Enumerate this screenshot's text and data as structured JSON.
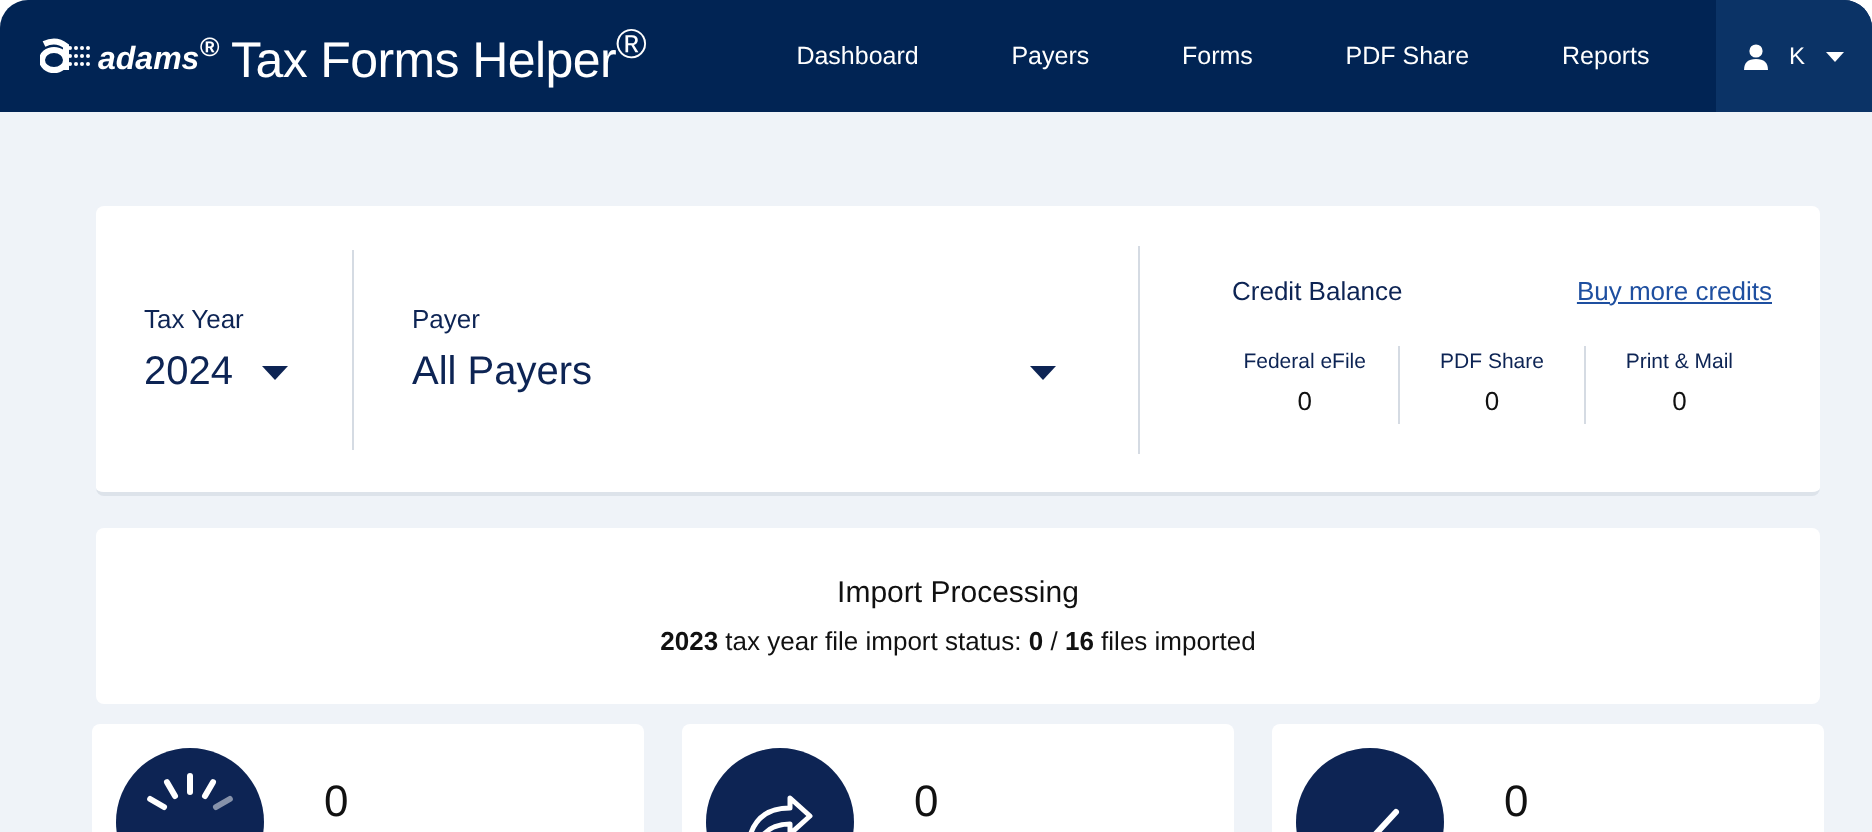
{
  "header": {
    "brand": "adams$^{®}$",
    "product": "Tax Forms Helper$^{®}$",
    "nav": [
      {
        "label": "Dashboard",
        "selected": false
      },
      {
        "label": "Payers",
        "selected": false
      },
      {
        "label": "Forms",
        "selected": false
      },
      {
        "label": "PDF Share",
        "selected": false
      },
      {
        "label": "Reports",
        "selected": false
      }
    ],
    "user": "K"
  },
  "filters": {
    "tax_year": {
      "label": "Tax Year",
      "value": "2024"
    },
    "payer": {
      "label": "Payer",
      "value": "All Payers"
    }
  },
  "credits": {
    "title": "Credit Balance",
    "link": "Buy more credits",
    "items": [
      {
        "label": "Federal eFile",
        "value": "0"
      },
      {
        "label": "PDF Share",
        "value": "0"
      },
      {
        "label": "Print & Mail",
        "value": "0"
      }
    ]
  },
  "import": {
    "title": "Import Processing",
    "status": "**2023** tax year file import status: **0** / **16** files imported"
  },
  "stats": [
    {
      "kind": "pending",
      "value": "0"
    },
    {
      "kind": "sent",
      "value": "0"
    },
    {
      "kind": "done",
      "value": "0"
    }
  ]
}
